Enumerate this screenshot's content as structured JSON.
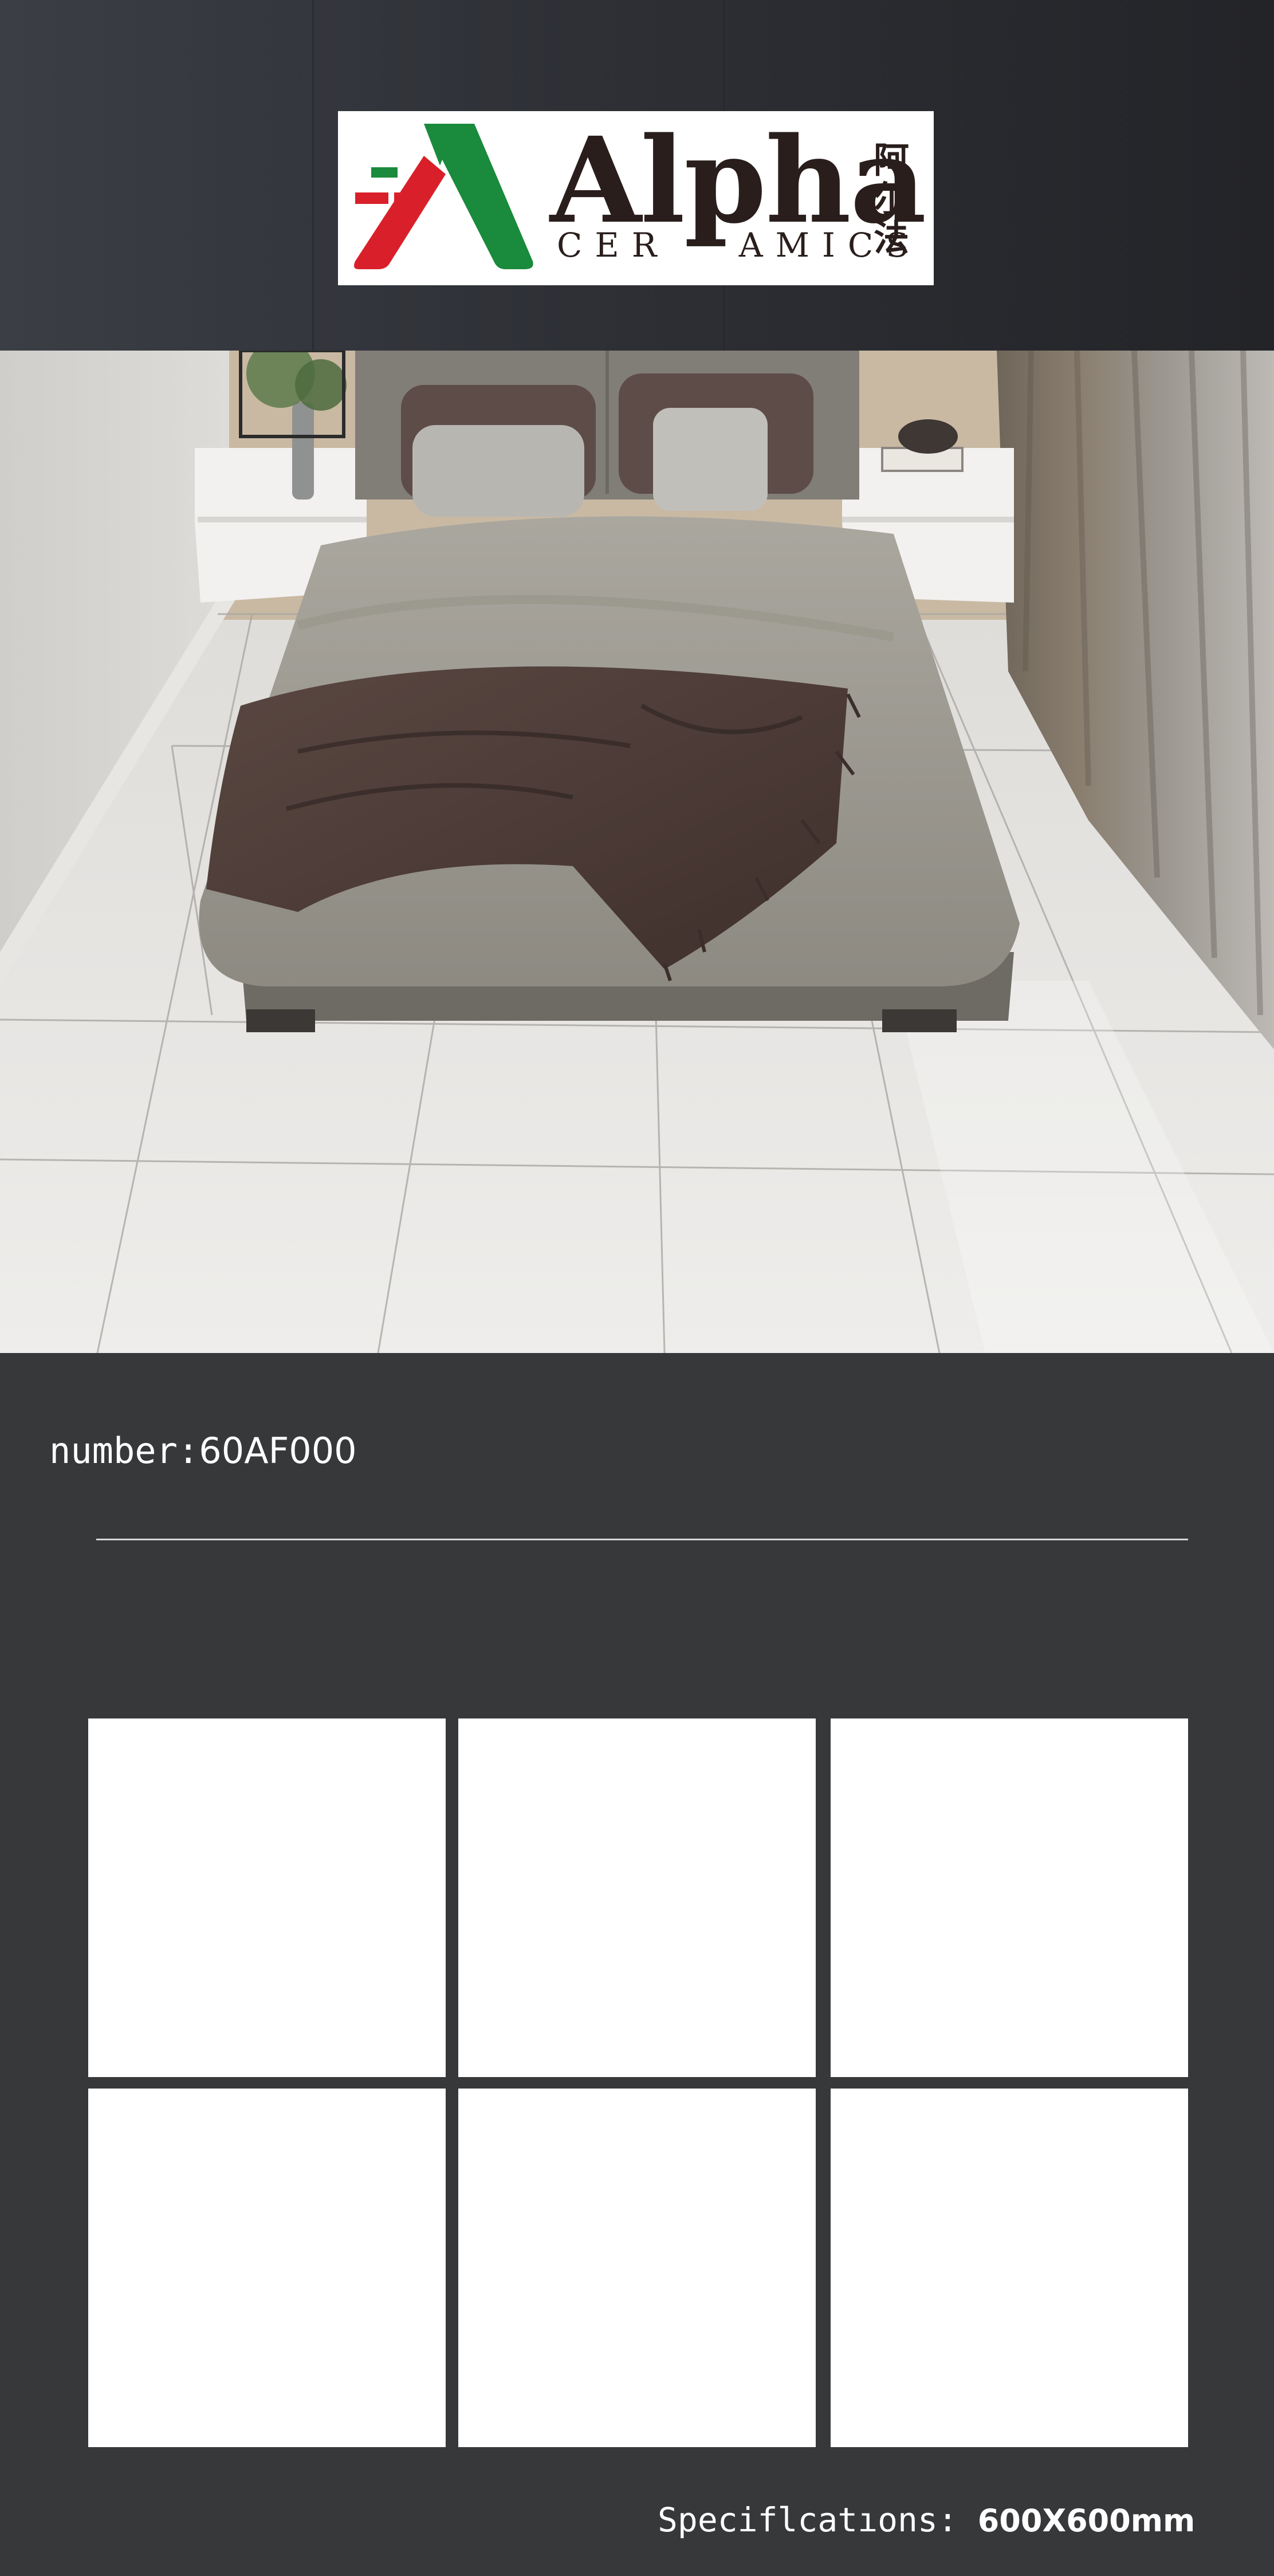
{
  "brand": {
    "name": "Alpha",
    "sub_left": "CER",
    "sub_right": "AMICS",
    "chinese": "阿尔法",
    "colors": {
      "green": "#1a8a3c",
      "red": "#d9202a",
      "dark": "#2a1e1c"
    }
  },
  "product": {
    "number_label": "number:",
    "number_value": "60AF000",
    "spec_label": "Speciflcatıons:",
    "spec_value": "600X600mm"
  },
  "swatches": [
    {
      "color": "#ffffff"
    },
    {
      "color": "#ffffff"
    },
    {
      "color": "#ffffff"
    },
    {
      "color": "#ffffff"
    },
    {
      "color": "#ffffff"
    },
    {
      "color": "#ffffff"
    }
  ],
  "colors": {
    "background": "#37383a",
    "tile": "#ffffff"
  }
}
